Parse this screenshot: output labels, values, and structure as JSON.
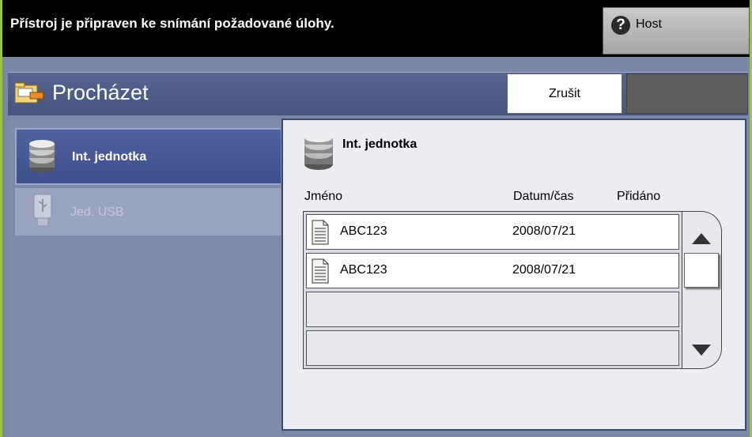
{
  "status": {
    "message": "Přístroj je připraven ke snímání požadované úlohy.",
    "host_label": "Host",
    "host_icon": "help-icon"
  },
  "header": {
    "title": "Procházet",
    "title_icon": "folder-browse-icon",
    "cancel_label": "Zrušit"
  },
  "sources": [
    {
      "label": "Int. jednotka",
      "icon": "disk-drive-icon",
      "selected": true
    },
    {
      "label": "Jed. USB",
      "icon": "usb-drive-icon",
      "selected": false
    }
  ],
  "pane": {
    "title": "Int. jednotka",
    "columns": {
      "name": "Jméno",
      "date": "Datum/čas",
      "added": "Přidáno"
    },
    "files": [
      {
        "name": "ABC123",
        "date": "2008/07/21"
      },
      {
        "name": "ABC123",
        "date": "2008/07/21"
      }
    ]
  },
  "colors": {
    "accent_border": "#9bc44b",
    "header_bg": "#4e5e88",
    "selected_source_bg": "#46579a"
  }
}
